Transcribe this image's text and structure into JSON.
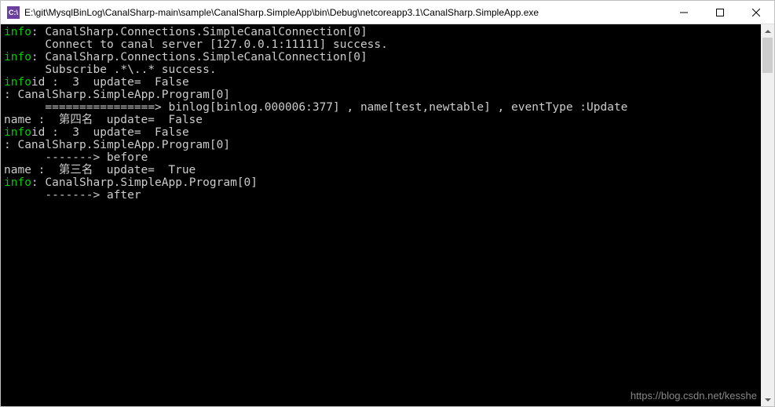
{
  "window": {
    "icon_label": "C:\\",
    "title": "E:\\git\\MysqlBinLog\\CanalSharp-main\\sample\\CanalSharp.SimpleApp\\bin\\Debug\\netcoreapp3.1\\CanalSharp.SimpleApp.exe",
    "minimize_label": "Minimize",
    "maximize_label": "Maximize",
    "close_label": "Close"
  },
  "console": {
    "lines": [
      {
        "prefix": "info",
        "text": ": CanalSharp.Connections.SimpleCanalConnection[0]"
      },
      {
        "prefix": "",
        "text": "      Connect to canal server [127.0.0.1:11111] success."
      },
      {
        "prefix": "info",
        "text": ": CanalSharp.Connections.SimpleCanalConnection[0]"
      },
      {
        "prefix": "",
        "text": "      Subscribe .*\\..* success."
      },
      {
        "prefix": "info",
        "text": "id :  3  update=  False"
      },
      {
        "prefix": "",
        "text": ": CanalSharp.SimpleApp.Program[0]"
      },
      {
        "prefix": "",
        "text": "      ================> binlog[binlog.000006:377] , name[test,newtable] , eventType :Update"
      },
      {
        "prefix": "",
        "text": "name :  第四名  update=  False"
      },
      {
        "prefix": "info",
        "text": "id :  3  update=  False"
      },
      {
        "prefix": "",
        "text": ": CanalSharp.SimpleApp.Program[0]"
      },
      {
        "prefix": "",
        "text": "      -------> before"
      },
      {
        "prefix": "",
        "text": "name :  第三名  update=  True"
      },
      {
        "prefix": "info",
        "text": ": CanalSharp.SimpleApp.Program[0]"
      },
      {
        "prefix": "",
        "text": "      -------> after"
      }
    ]
  },
  "watermark": "https://blog.csdn.net/kesshe"
}
